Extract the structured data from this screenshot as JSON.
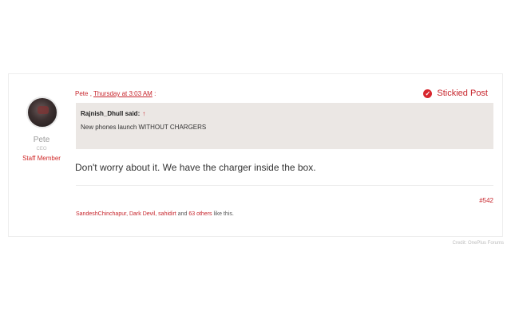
{
  "post": {
    "author": "Pete",
    "meta_name": "Pete",
    "meta_separator": ",",
    "meta_time": "Thursday at 3:03 AM",
    "meta_trailing": ":",
    "sticky_label": "Stickied Post",
    "user": {
      "name": "Pete",
      "title": "CEO",
      "role": "Staff Member"
    },
    "quote": {
      "author": "Rajnish_Dhull said:",
      "arrow": "↑",
      "text": "New phones launch WITHOUT CHARGERS"
    },
    "message": "Don't worry about it. We have the charger inside the box.",
    "post_number": "#542",
    "likes": {
      "user1": "SandeshChinchapur",
      "sep1": ",",
      "user2": "Dark Devil",
      "sep2": ",",
      "user3": "sahidirt",
      "and": "and",
      "others": "63 others",
      "suffix": "like this."
    }
  },
  "credit": "Credit: OnePlus Forums",
  "colors": {
    "accent": "#c7252c",
    "quote_bg": "#ebe7e4"
  }
}
